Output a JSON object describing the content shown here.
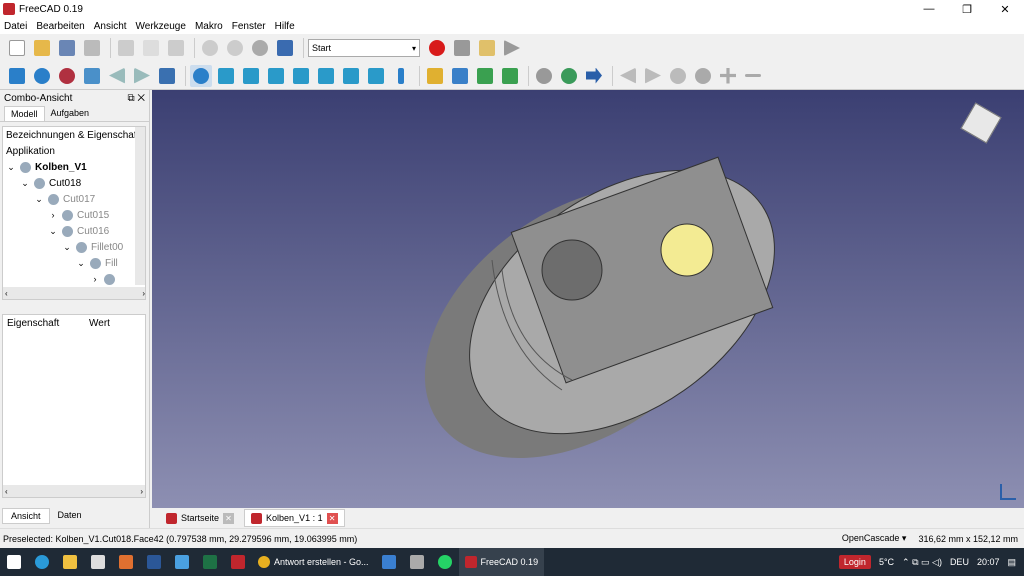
{
  "window": {
    "title": "FreeCAD 0.19",
    "controls": [
      "—",
      "❐",
      "✕"
    ]
  },
  "menu": [
    "Datei",
    "Bearbeiten",
    "Ansicht",
    "Werkzeuge",
    "Makro",
    "Fenster",
    "Hilfe"
  ],
  "toolbar": {
    "workbench": "Start",
    "icons_row1": [
      "new-icon",
      "open-icon",
      "save-icon",
      "print-icon",
      "cut-icon",
      "copy-icon",
      "paste-icon",
      "undo-icon",
      "redo-icon",
      "refresh-icon",
      "whatsthis-icon",
      "record-macro-icon",
      "stop-macro-icon",
      "edit-macro-icon",
      "run-macro-icon"
    ],
    "icons_row2": [
      "fit-all-icon",
      "fit-selection-icon",
      "draw-style-icon",
      "bounding-box-icon",
      "back-icon",
      "forward-icon",
      "std-view-icon",
      "zoom-icon",
      "iso-view-icon",
      "front-view-icon",
      "top-view-icon",
      "right-view-icon",
      "rear-view-icon",
      "bottom-view-icon",
      "left-view-icon",
      "measure-icon",
      "part-icon",
      "group-icon",
      "link-icon",
      "link-actions-icon",
      "url-icon",
      "web-icon",
      "go-icon",
      "nav-back-icon",
      "nav-forward-icon",
      "reload-icon",
      "stop-icon",
      "zoom-in-icon",
      "zoom-out-icon"
    ],
    "colors": {
      "accent": "#2a7fc9",
      "record": "#d81b1b"
    }
  },
  "combo": {
    "title": "Combo-Ansicht",
    "tabs": [
      "Modell",
      "Aufgaben"
    ],
    "section": "Bezeichnungen & Eigenschaft",
    "tree": [
      {
        "label": "Applikation",
        "level": 0,
        "expand": "",
        "icon": false,
        "style": ""
      },
      {
        "label": "Kolben_V1",
        "level": 0,
        "expand": "⌄",
        "icon": true,
        "style": "bold"
      },
      {
        "label": "Cut018",
        "level": 1,
        "expand": "⌄",
        "icon": true,
        "style": ""
      },
      {
        "label": "Cut017",
        "level": 2,
        "expand": "⌄",
        "icon": true,
        "style": "dim"
      },
      {
        "label": "Cut015",
        "level": 3,
        "expand": "›",
        "icon": true,
        "style": "dim"
      },
      {
        "label": "Cut016",
        "level": 3,
        "expand": "⌄",
        "icon": true,
        "style": "dim"
      },
      {
        "label": "Fillet00",
        "level": 4,
        "expand": "⌄",
        "icon": true,
        "style": "dim"
      },
      {
        "label": "Fill",
        "level": 5,
        "expand": "⌄",
        "icon": true,
        "style": "dim"
      },
      {
        "label": "",
        "level": 6,
        "expand": "›",
        "icon": true,
        "style": "dim"
      }
    ],
    "props_headers": [
      "Eigenschaft",
      "Wert"
    ],
    "bottom_tabs": [
      "Ansicht",
      "Daten"
    ]
  },
  "documents": [
    {
      "label": "Startseite",
      "active": false
    },
    {
      "label": "Kolben_V1 : 1",
      "active": true
    }
  ],
  "status": {
    "preselected": "Preselected: Kolben_V1.Cut018.Face42 (0.797538 mm, 29.279596 mm, 19.063995 mm)",
    "nav_style": "OpenCascade",
    "dimensions": "316,62 mm x 152,12 mm"
  },
  "taskbar": {
    "apps": [
      {
        "label": "Antwort erstellen - Go...",
        "active": false
      },
      {
        "label": "FreeCAD 0.19",
        "active": true
      }
    ],
    "login": "Login",
    "temp": "5°C",
    "lang": "DEU",
    "time": "20:07"
  },
  "viewport": {
    "bg_top": "#3b3f72",
    "bg_bottom": "#8d8fb2",
    "part_color": "#a9a9a9",
    "hole_color": "#f3eb93"
  }
}
